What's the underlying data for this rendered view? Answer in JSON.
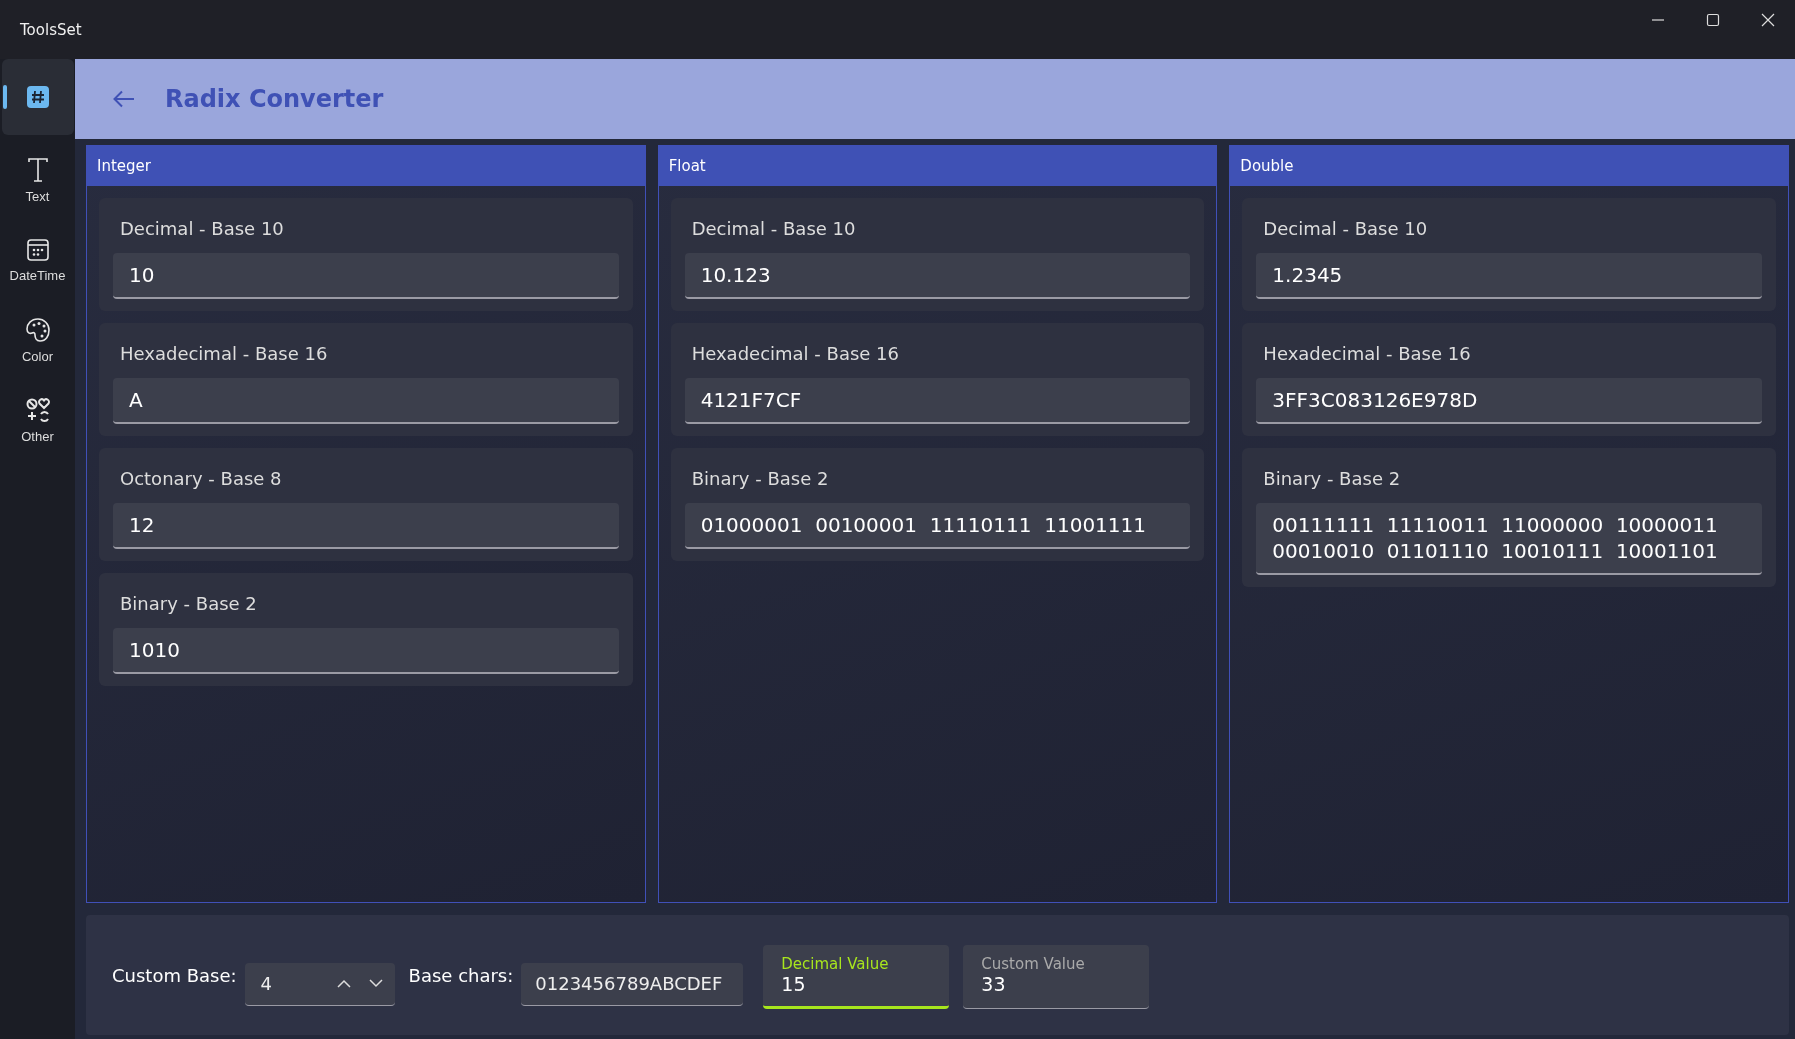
{
  "window": {
    "title": "ToolsSet"
  },
  "sidebar": {
    "items": [
      {
        "selected": true
      },
      {
        "label": "Text",
        "selected": false
      },
      {
        "label": "DateTime",
        "selected": false
      },
      {
        "label": "Color",
        "selected": false
      },
      {
        "label": "Other",
        "selected": false
      }
    ]
  },
  "header": {
    "title": "Radix Converter"
  },
  "sections": [
    {
      "title": "Integer",
      "fields": [
        {
          "label": "Decimal - Base 10",
          "lines": [
            "10"
          ]
        },
        {
          "label": "Hexadecimal - Base 16",
          "lines": [
            "A"
          ]
        },
        {
          "label": "Octonary - Base 8",
          "lines": [
            "12"
          ]
        },
        {
          "label": "Binary - Base 2",
          "lines": [
            "1010"
          ]
        }
      ]
    },
    {
      "title": "Float",
      "fields": [
        {
          "label": "Decimal - Base 10",
          "lines": [
            "10.123"
          ]
        },
        {
          "label": "Hexadecimal - Base 16",
          "lines": [
            "4121F7CF"
          ]
        },
        {
          "label": "Binary - Base 2",
          "lines": [
            "01000001  00100001  11110111  11001111"
          ]
        }
      ]
    },
    {
      "title": "Double",
      "fields": [
        {
          "label": "Decimal - Base 10",
          "lines": [
            "1.2345"
          ]
        },
        {
          "label": "Hexadecimal - Base 16",
          "lines": [
            "3FF3C083126E978D"
          ]
        },
        {
          "label": "Binary - Base 2",
          "lines": [
            "00111111  11110011  11000000  10000011",
            "00010010  01101110  10010111  10001101"
          ]
        }
      ]
    }
  ],
  "bottom": {
    "custom_base": {
      "label": "Custom Base:",
      "value": "4"
    },
    "base_chars": {
      "label": "Base chars:",
      "value": "0123456789ABCDEF"
    },
    "values": [
      {
        "label": "Decimal Value",
        "value": "15",
        "focused": true
      },
      {
        "label": "Custom Value",
        "value": "33",
        "focused": false
      }
    ]
  }
}
